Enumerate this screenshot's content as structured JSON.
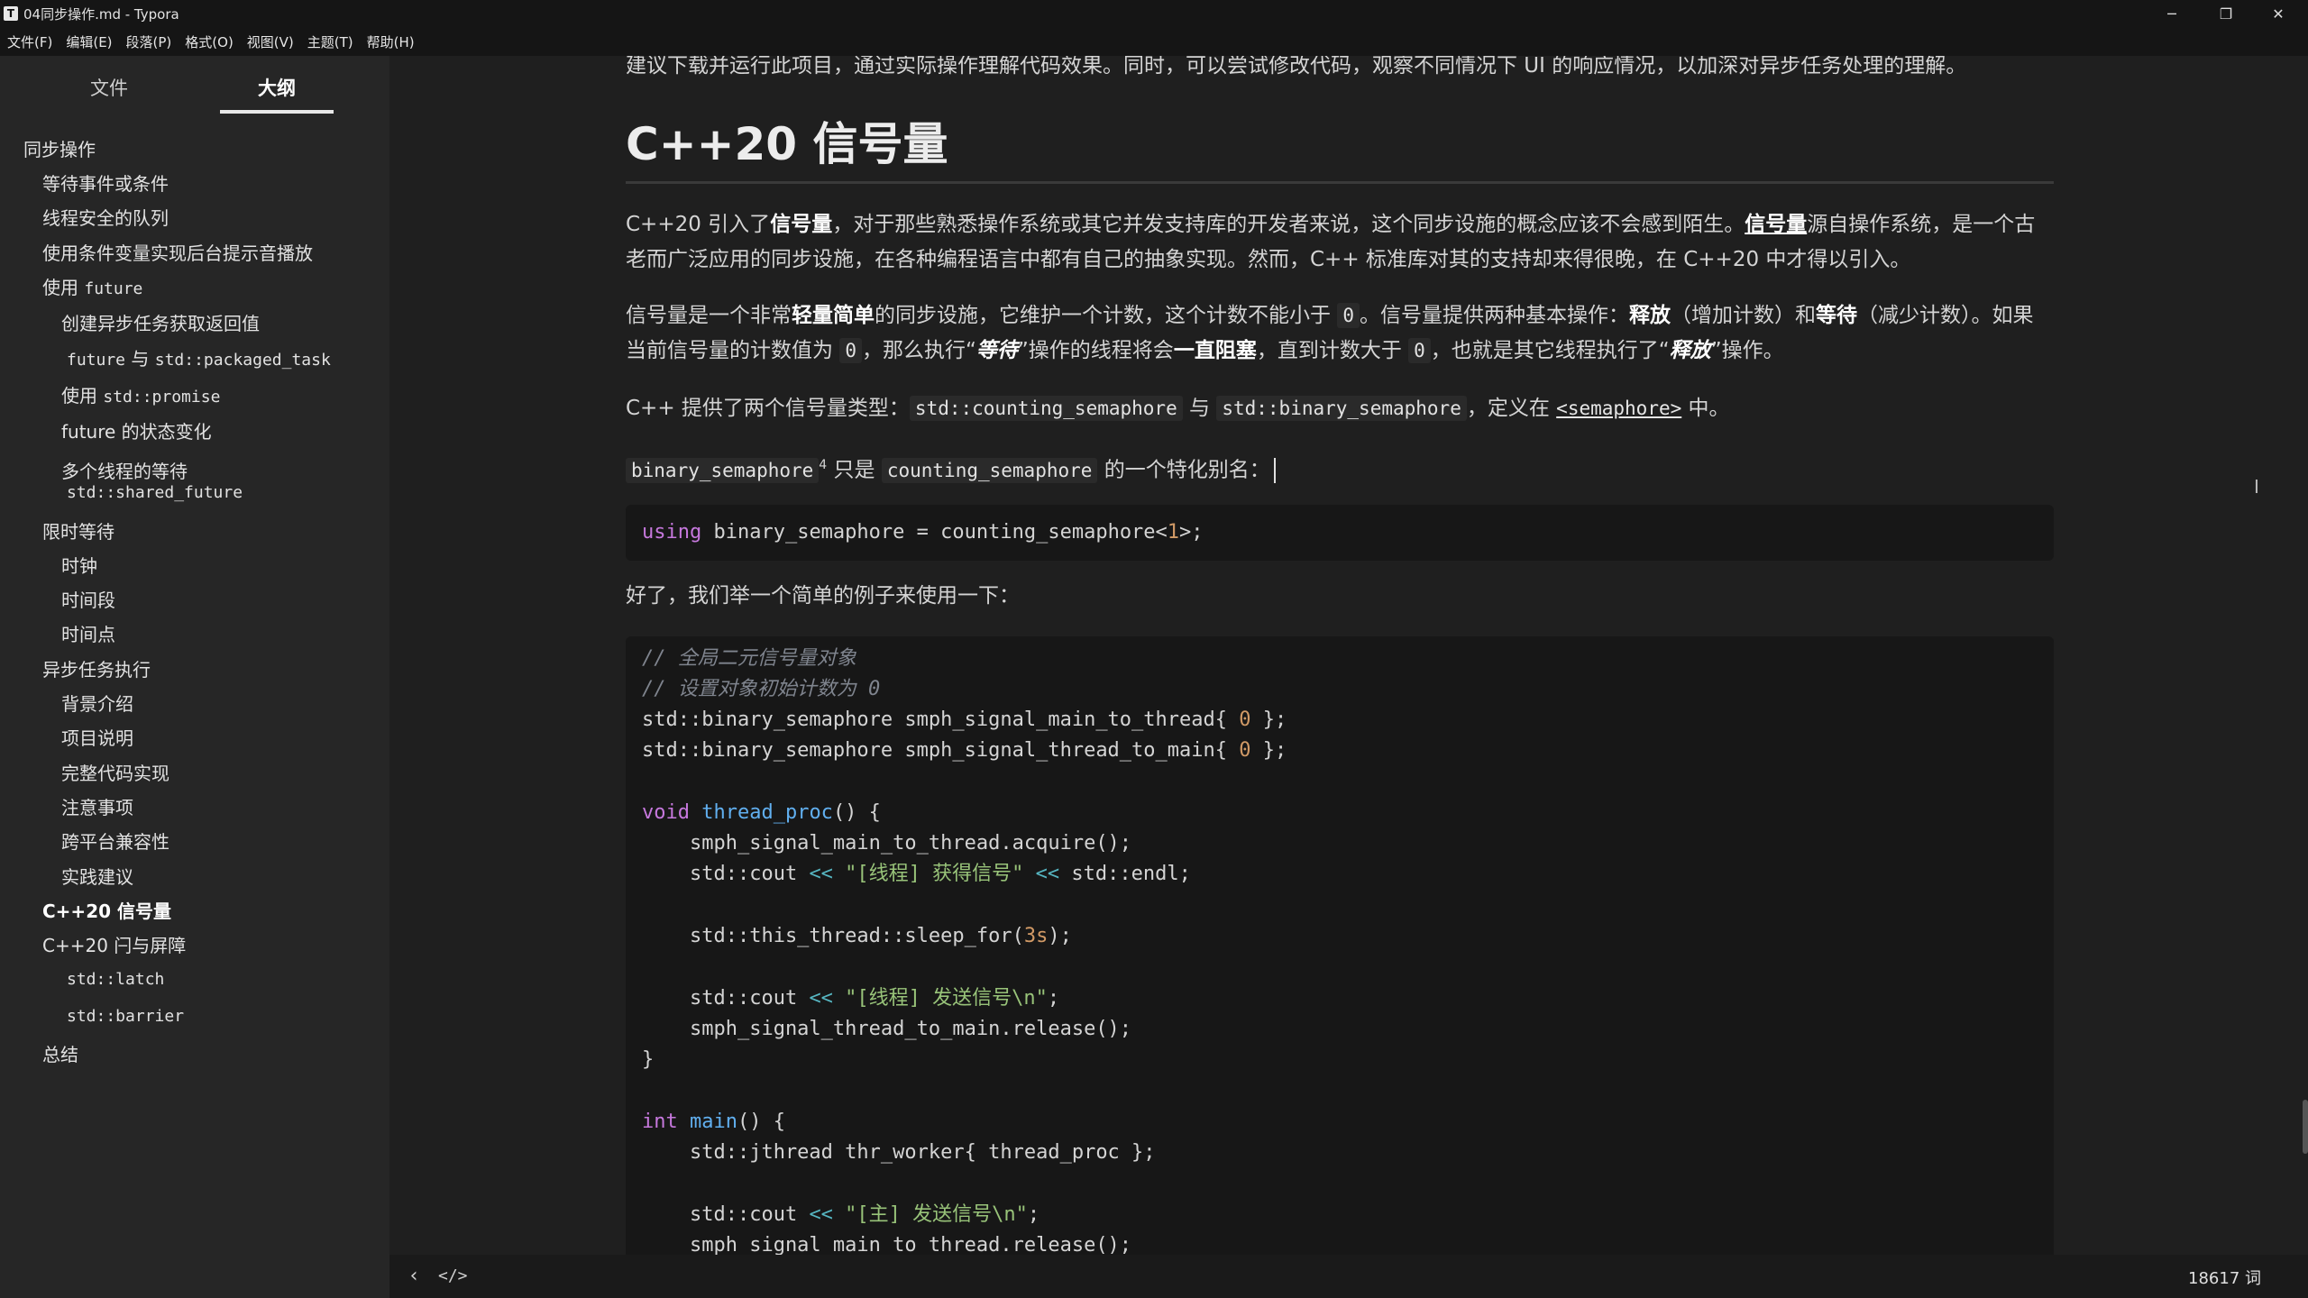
{
  "window": {
    "title": "04同步操作.md - Typora",
    "app_icon": "T",
    "minimize": "─",
    "restore": "❐",
    "close": "✕"
  },
  "menu": [
    "文件(F)",
    "编辑(E)",
    "段落(P)",
    "格式(O)",
    "视图(V)",
    "主题(T)",
    "帮助(H)"
  ],
  "sidebar": {
    "tabs": {
      "files": "文件",
      "outline": "大纲"
    },
    "outline": [
      {
        "text": "同步操作"
      },
      {
        "text": "等待事件或条件"
      },
      {
        "text": "线程安全的队列"
      },
      {
        "text": "使用条件变量实现后台提示音播放"
      },
      {
        "pre": "使用 ",
        "code": "future"
      },
      {
        "text": "创建异步任务获取返回值"
      },
      {
        "code": "future",
        "mid": " 与 ",
        "code2": "std::packaged_task"
      },
      {
        "pre": "使用 ",
        "code": "std::promise"
      },
      {
        "text": "future 的状态变化"
      },
      {
        "text": "多个线程的等待"
      },
      {
        "code": "std::shared_future"
      },
      {
        "text": "限时等待"
      },
      {
        "text": "时钟"
      },
      {
        "text": "时间段"
      },
      {
        "text": "时间点"
      },
      {
        "text": "异步任务执行"
      },
      {
        "text": "背景介绍"
      },
      {
        "text": "项目说明"
      },
      {
        "text": "完整代码实现"
      },
      {
        "text": "注意事项"
      },
      {
        "text": "跨平台兼容性"
      },
      {
        "text": "实践建议"
      },
      {
        "text": "C++20 信号量"
      },
      {
        "text": "C++20 闩与屏障"
      },
      {
        "code": "std::latch"
      },
      {
        "code": "std::barrier"
      },
      {
        "text": "总结"
      }
    ]
  },
  "article": {
    "top_line": "建议下载并运行此项目，通过实际操作理解代码效果。同时，可以尝试修改代码，观察不同情况下 UI 的响应情况，以加深对异步任务处理的理解。",
    "heading": "C++20 信号量",
    "p1": {
      "a": "C++20 引入了",
      "b": "信号量",
      "c": "，对于那些熟悉操作系统或其它并发支持库的开发者来说，这个同步设施的概念应该不会感到陌生。",
      "d": "信号量",
      "e": "源自操作系统，是一个古老而广泛应用的同步设施，在各种编程语言中都有自己的抽象实现。然而，C++ 标准库对其的支持却来得很晚，在 C++20 中才得以引入。"
    },
    "p2": {
      "a": "信号量是一个非常",
      "b": "轻量简单",
      "c": "的同步设施，它维护一个计数，这个计数不能小于 ",
      "d": "0",
      "e": "。信号量提供两种基本操作：",
      "f": "释放",
      "g": "（增加计数）和",
      "h": "等待",
      "i": "（减少计数）。如果当前信号量的计数值为 ",
      "j": "0",
      "k": "，那么执行“",
      "l": "等待",
      "m": "”操作的线程将会",
      "n": "一直阻塞",
      "o": "，直到计数大于 ",
      "p": "0",
      "q": "，也就是其它线程执行了“",
      "r": "释放",
      "s": "”操作。"
    },
    "p3": {
      "a": "C++ 提供了两个信号量类型：",
      "b": "std::counting_semaphore",
      "c": " 与 ",
      "d": "std::binary_semaphore",
      "e": "，定义在 ",
      "f": "<semaphore>",
      "g": " 中。"
    },
    "p4": {
      "a": "binary_semaphore",
      "sup": "4",
      "b": " 只是 ",
      "c": "counting_semaphore",
      "d": " 的一个特化别名："
    },
    "code1": {
      "kw": "using",
      "rest1": " binary_semaphore = counting_semaphore<",
      "num": "1",
      "rest2": ">;"
    },
    "p5": "好了，我们举一个简单的例子来使用一下："
  },
  "code2_lines": {
    "l1": "// 全局二元信号量对象",
    "l2": "// 设置对象初始计数为 0",
    "l3a": "std::binary_semaphore smph_signal_main_to_thread{ ",
    "l3n": "0",
    "l3b": " };",
    "l4a": "std::binary_semaphore smph_signal_thread_to_main{ ",
    "l4n": "0",
    "l4b": " };",
    "l6kw": "void",
    "l6fn": "thread_proc",
    "l6r": "() {",
    "l7": "    smph_signal_main_to_thread.acquire();",
    "l8a": "    std::cout ",
    "l8op": "<<",
    "l8s": " \"[线程] 获得信号\"",
    "l8op2": " <<",
    "l8b": " std::endl;",
    "l10a": "    std::this_thread::sleep_for(",
    "l10n": "3s",
    "l10b": ");",
    "l12a": "    std::cout ",
    "l12op": "<<",
    "l12s": " \"[线程] 发送信号\\n\"",
    "l12b": ";",
    "l13": "    smph_signal_thread_to_main.release();",
    "l14": "}",
    "l16kw": "int",
    "l16fn": " main",
    "l16r": "() {",
    "l17": "    std::jthread thr_worker{ thread_proc };",
    "l19a": "    std::cout ",
    "l19op": "<<",
    "l19s": " \"[主] 发送信号\\n\"",
    "l19b": ";",
    "l20": "    smph_signal_main_to_thread.release();"
  },
  "status": {
    "toggle": "‹",
    "source": "</>",
    "word_count": "18617 词"
  }
}
